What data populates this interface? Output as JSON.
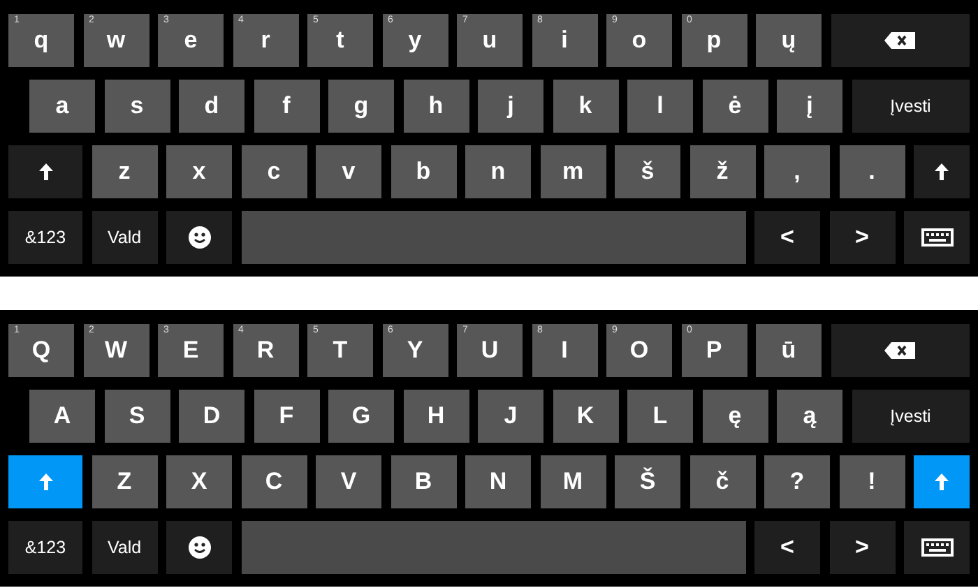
{
  "keyboards": [
    {
      "rows": [
        [
          {
            "kind": "letter",
            "label": "q",
            "hint": "1"
          },
          {
            "kind": "letter",
            "label": "w",
            "hint": "2"
          },
          {
            "kind": "letter",
            "label": "e",
            "hint": "3"
          },
          {
            "kind": "letter",
            "label": "r",
            "hint": "4"
          },
          {
            "kind": "letter",
            "label": "t",
            "hint": "5"
          },
          {
            "kind": "letter",
            "label": "y",
            "hint": "6"
          },
          {
            "kind": "letter",
            "label": "u",
            "hint": "7"
          },
          {
            "kind": "letter",
            "label": "i",
            "hint": "8"
          },
          {
            "kind": "letter",
            "label": "o",
            "hint": "9"
          },
          {
            "kind": "letter",
            "label": "p",
            "hint": "0"
          },
          {
            "kind": "letter",
            "label": "ų"
          },
          {
            "kind": "backspace"
          }
        ],
        [
          {
            "kind": "letter",
            "label": "a"
          },
          {
            "kind": "letter",
            "label": "s"
          },
          {
            "kind": "letter",
            "label": "d"
          },
          {
            "kind": "letter",
            "label": "f"
          },
          {
            "kind": "letter",
            "label": "g"
          },
          {
            "kind": "letter",
            "label": "h"
          },
          {
            "kind": "letter",
            "label": "j"
          },
          {
            "kind": "letter",
            "label": "k"
          },
          {
            "kind": "letter",
            "label": "l"
          },
          {
            "kind": "letter",
            "label": "ė"
          },
          {
            "kind": "letter",
            "label": "į"
          },
          {
            "kind": "enter",
            "label": "Įvesti"
          }
        ],
        [
          {
            "kind": "shift",
            "on": false
          },
          {
            "kind": "letter",
            "label": "z"
          },
          {
            "kind": "letter",
            "label": "x"
          },
          {
            "kind": "letter",
            "label": "c"
          },
          {
            "kind": "letter",
            "label": "v"
          },
          {
            "kind": "letter",
            "label": "b"
          },
          {
            "kind": "letter",
            "label": "n"
          },
          {
            "kind": "letter",
            "label": "m"
          },
          {
            "kind": "letter",
            "label": "š"
          },
          {
            "kind": "letter",
            "label": "ž"
          },
          {
            "kind": "letter",
            "label": ","
          },
          {
            "kind": "letter",
            "label": "."
          },
          {
            "kind": "shift",
            "on": false
          }
        ],
        [
          {
            "kind": "func",
            "label": "&123"
          },
          {
            "kind": "func",
            "label": "Vald"
          },
          {
            "kind": "emoji"
          },
          {
            "kind": "space"
          },
          {
            "kind": "arrow",
            "label": "<"
          },
          {
            "kind": "arrow",
            "label": ">"
          },
          {
            "kind": "hide"
          }
        ]
      ]
    },
    {
      "rows": [
        [
          {
            "kind": "letter",
            "label": "Q",
            "hint": "1"
          },
          {
            "kind": "letter",
            "label": "W",
            "hint": "2"
          },
          {
            "kind": "letter",
            "label": "E",
            "hint": "3"
          },
          {
            "kind": "letter",
            "label": "R",
            "hint": "4"
          },
          {
            "kind": "letter",
            "label": "T",
            "hint": "5"
          },
          {
            "kind": "letter",
            "label": "Y",
            "hint": "6"
          },
          {
            "kind": "letter",
            "label": "U",
            "hint": "7"
          },
          {
            "kind": "letter",
            "label": "I",
            "hint": "8"
          },
          {
            "kind": "letter",
            "label": "O",
            "hint": "9"
          },
          {
            "kind": "letter",
            "label": "P",
            "hint": "0"
          },
          {
            "kind": "letter",
            "label": "ū"
          },
          {
            "kind": "backspace"
          }
        ],
        [
          {
            "kind": "letter",
            "label": "A"
          },
          {
            "kind": "letter",
            "label": "S"
          },
          {
            "kind": "letter",
            "label": "D"
          },
          {
            "kind": "letter",
            "label": "F"
          },
          {
            "kind": "letter",
            "label": "G"
          },
          {
            "kind": "letter",
            "label": "H"
          },
          {
            "kind": "letter",
            "label": "J"
          },
          {
            "kind": "letter",
            "label": "K"
          },
          {
            "kind": "letter",
            "label": "L"
          },
          {
            "kind": "letter",
            "label": "ę"
          },
          {
            "kind": "letter",
            "label": "ą"
          },
          {
            "kind": "enter",
            "label": "Įvesti"
          }
        ],
        [
          {
            "kind": "shift",
            "on": true
          },
          {
            "kind": "letter",
            "label": "Z"
          },
          {
            "kind": "letter",
            "label": "X"
          },
          {
            "kind": "letter",
            "label": "C"
          },
          {
            "kind": "letter",
            "label": "V"
          },
          {
            "kind": "letter",
            "label": "B"
          },
          {
            "kind": "letter",
            "label": "N"
          },
          {
            "kind": "letter",
            "label": "M"
          },
          {
            "kind": "letter",
            "label": "Š"
          },
          {
            "kind": "letter",
            "label": "č"
          },
          {
            "kind": "letter",
            "label": "?"
          },
          {
            "kind": "letter",
            "label": "!"
          },
          {
            "kind": "shift",
            "on": true
          }
        ],
        [
          {
            "kind": "func",
            "label": "&123"
          },
          {
            "kind": "func",
            "label": "Vald"
          },
          {
            "kind": "emoji"
          },
          {
            "kind": "space"
          },
          {
            "kind": "arrow",
            "label": "<"
          },
          {
            "kind": "arrow",
            "label": ">"
          },
          {
            "kind": "hide"
          }
        ]
      ]
    }
  ]
}
